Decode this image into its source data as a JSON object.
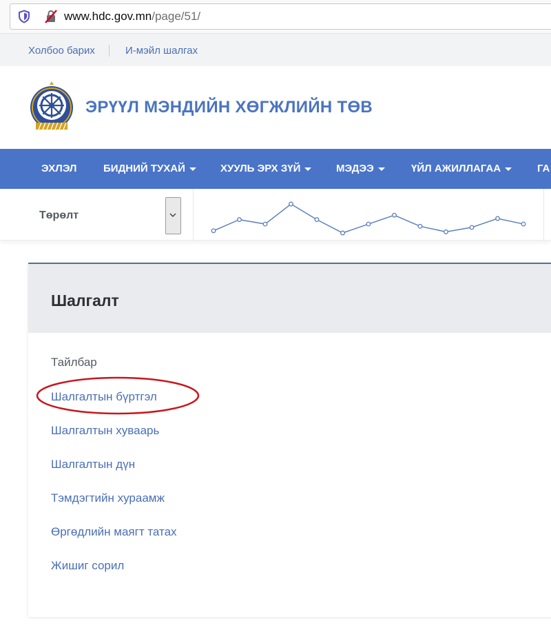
{
  "browser": {
    "url_host": "www.hdc.gov.mn",
    "url_path": "/page/51/"
  },
  "topbar": {
    "contact": "Холбоо барих",
    "email_check": "И-мэйл шалгах"
  },
  "header": {
    "title": "ЭРҮҮЛ МЭНДИЙН ХӨГЖЛИЙН ТӨВ"
  },
  "nav": {
    "items": [
      {
        "label": "ЭХЛЭЛ",
        "dropdown": false
      },
      {
        "label": "БИДНИЙ ТУХАЙ",
        "dropdown": true
      },
      {
        "label": "ХУУЛЬ ЭРХ ЗҮЙ",
        "dropdown": true
      },
      {
        "label": "МЭДЭЭ",
        "dropdown": true
      },
      {
        "label": "ҮЙЛ АЖИЛЛАГАА",
        "dropdown": true
      },
      {
        "label": "ГА",
        "dropdown": false
      }
    ]
  },
  "filter": {
    "label": "Төрөлт"
  },
  "sparkline": {
    "values": [
      2.0,
      3.0,
      2.6,
      4.4,
      3.0,
      1.8,
      2.6,
      3.4,
      2.4,
      1.9,
      2.3,
      3.1,
      2.6
    ],
    "color": "#5c7fc0"
  },
  "card": {
    "title": "Шалгалт",
    "links": [
      {
        "label": "Тайлбар",
        "plain": true
      },
      {
        "label": "Шалгалтын бүртгэл",
        "plain": false,
        "circled": true
      },
      {
        "label": "Шалгалтын хуваарь",
        "plain": false
      },
      {
        "label": "Шалгалтын дүн",
        "plain": false
      },
      {
        "label": "Тэмдэгтийн хураамж",
        "plain": false
      },
      {
        "label": "Өргөдлийн маягт татах",
        "plain": false
      },
      {
        "label": "Жишиг сорил",
        "plain": false
      }
    ]
  },
  "colors": {
    "accent": "#4a74c8",
    "link": "#4a6fb5",
    "annotation": "#c8161d"
  }
}
